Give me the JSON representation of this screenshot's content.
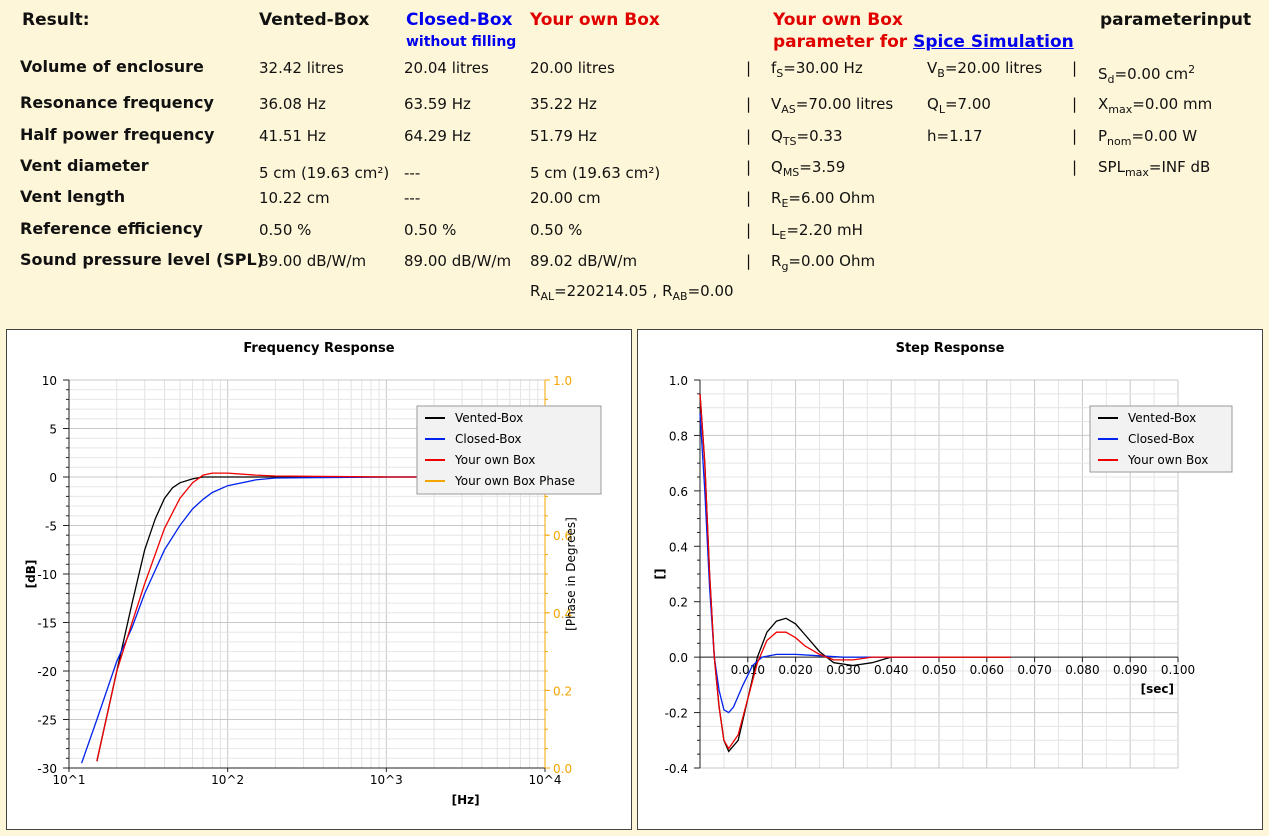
{
  "headers": {
    "result": "Result:",
    "vented": "Vented-Box",
    "closed": "Closed-Box",
    "closed_sub": "without filling",
    "own": "Your own Box",
    "spice_title": "Your own Box",
    "spice_sub_prefix": "parameter for ",
    "spice_link": "Spice Simulation",
    "param_input": "parameterinput"
  },
  "rows": [
    {
      "label": "Volume of enclosure",
      "vented": "32.42 litres",
      "closed": "20.04 litres",
      "own": "20.00 litres"
    },
    {
      "label": "Resonance frequency",
      "vented": "36.08 Hz",
      "closed": "63.59 Hz",
      "own": "35.22 Hz"
    },
    {
      "label": "Half power frequency",
      "vented": "41.51 Hz",
      "closed": "64.29 Hz",
      "own": "51.79 Hz"
    },
    {
      "label": "Vent diameter",
      "vented": "5 cm (19.63 cm²)",
      "closed": "---",
      "own": "5 cm (19.63 cm²)"
    },
    {
      "label": "Vent length",
      "vented": "10.22 cm",
      "closed": "---",
      "own": "20.00 cm"
    },
    {
      "label": "Reference efficiency",
      "vented": "0.50 %",
      "closed": "0.50 %",
      "own": "0.50 %"
    },
    {
      "label": "Sound pressure level (SPL)",
      "vented": "89.00 dB/W/m",
      "closed": "89.00 dB/W/m",
      "own": "89.02 dB/W/m"
    }
  ],
  "ral": {
    "ral_label": "R",
    "ral_sub": "AL",
    "ral_value": "=220214.05 , ",
    "rab_label": "R",
    "rab_sub": "AB",
    "rab_value": "=0.00"
  },
  "spice_params": [
    {
      "label": "f",
      "sub": "S",
      "value": "=30.00 Hz"
    },
    {
      "label": "V",
      "sub": "AS",
      "value": "=70.00 litres"
    },
    {
      "label": "Q",
      "sub": "TS",
      "value": "=0.33"
    },
    {
      "label": "Q",
      "sub": "MS",
      "value": "=3.59"
    },
    {
      "label": "R",
      "sub": "E",
      "value": "=6.00 Ohm"
    },
    {
      "label": "L",
      "sub": "E",
      "value": "=2.20 mH"
    },
    {
      "label": "R",
      "sub": "g",
      "value": "=0.00 Ohm"
    }
  ],
  "spice_params2": [
    {
      "label": "V",
      "sub": "B",
      "value": "=20.00 litres"
    },
    {
      "label": "Q",
      "sub": "L",
      "value": "=7.00"
    },
    {
      "label": "h",
      "sub": "",
      "value": "=1.17"
    }
  ],
  "input_params": [
    {
      "label": "S",
      "sub": "d",
      "value": "=0.00 cm",
      "sup": "2"
    },
    {
      "label": "X",
      "sub": "max",
      "value": "=0.00 mm",
      "sup": ""
    },
    {
      "label": "P",
      "sub": "nom",
      "value": "=0.00 W",
      "sup": ""
    },
    {
      "label": "SPL",
      "sub": "max",
      "value": "=INF dB",
      "sup": ""
    }
  ],
  "separator": "|",
  "colors": {
    "vented": "#000000",
    "closed": "#0022ee",
    "own": "#ee0000",
    "phase": "#f5a500"
  },
  "chart_data": [
    {
      "type": "line",
      "title": "Frequency Response",
      "xlabel": "[Hz]",
      "ylabel": "[dB]",
      "y2label": "[Phase in Degrees]",
      "xscale": "log",
      "xlim": [
        10,
        10000
      ],
      "ylim": [
        -30,
        10
      ],
      "y2lim": [
        0.0,
        1.0
      ],
      "x_ticks": [
        "10^1",
        "10^2",
        "10^3",
        "10^4"
      ],
      "y_ticks": [
        "10",
        "5",
        "0",
        "-5",
        "-10",
        "-15",
        "-20",
        "-25",
        "-30"
      ],
      "y2_ticks": [
        "1.0",
        "0.8",
        "0.6",
        "0.4",
        "0.2",
        "0.0"
      ],
      "legend_position": "top-right",
      "series": [
        {
          "name": "Vented-Box",
          "x": [
            15,
            20,
            25,
            30,
            35,
            40,
            45,
            50,
            60,
            70,
            80,
            100,
            200,
            1000,
            10000
          ],
          "y": [
            -29.3,
            -20,
            -13,
            -7.5,
            -4.3,
            -2.2,
            -1.1,
            -0.6,
            -0.2,
            0,
            0,
            0,
            0,
            0,
            0
          ]
        },
        {
          "name": "Closed-Box",
          "x": [
            12,
            15,
            20,
            25,
            30,
            40,
            50,
            60,
            70,
            80,
            100,
            150,
            200,
            1000,
            10000
          ],
          "y": [
            -29.5,
            -25,
            -19,
            -15.5,
            -12,
            -7.5,
            -5,
            -3.3,
            -2.3,
            -1.6,
            -0.9,
            -0.3,
            -0.1,
            0,
            0
          ]
        },
        {
          "name": "Your own Box",
          "x": [
            15,
            20,
            25,
            30,
            40,
            50,
            60,
            70,
            80,
            100,
            150,
            200,
            1000,
            10000
          ],
          "y": [
            -29.3,
            -20,
            -15,
            -11,
            -5.3,
            -2.2,
            -0.6,
            0.2,
            0.4,
            0.4,
            0.2,
            0.1,
            0,
            0
          ]
        },
        {
          "name": "Your own Box Phase",
          "x": [],
          "y": []
        }
      ]
    },
    {
      "type": "line",
      "title": "Step Response",
      "xlabel": "[sec]",
      "ylabel": "[]",
      "xlim": [
        0,
        0.1
      ],
      "ylim": [
        -0.4,
        1.0
      ],
      "x_ticks": [
        "0.010",
        "0.020",
        "0.030",
        "0.040",
        "0.050",
        "0.060",
        "0.070",
        "0.080",
        "0.090",
        "0.100"
      ],
      "y_ticks": [
        "1.0",
        "0.8",
        "0.6",
        "0.4",
        "0.2",
        "0.0",
        "-0.2",
        "-0.4"
      ],
      "legend_position": "top-right",
      "series": [
        {
          "name": "Vented-Box",
          "x": [
            0,
            0.001,
            0.002,
            0.003,
            0.004,
            0.005,
            0.006,
            0.008,
            0.01,
            0.012,
            0.014,
            0.016,
            0.018,
            0.02,
            0.022,
            0.025,
            0.028,
            0.032,
            0.036,
            0.04,
            0.05,
            0.065
          ],
          "y": [
            0.95,
            0.7,
            0.3,
            0.0,
            -0.18,
            -0.3,
            -0.34,
            -0.3,
            -0.15,
            0.0,
            0.09,
            0.13,
            0.14,
            0.12,
            0.08,
            0.02,
            -0.02,
            -0.03,
            -0.02,
            0,
            0,
            0
          ]
        },
        {
          "name": "Closed-Box",
          "x": [
            0,
            0.001,
            0.002,
            0.003,
            0.004,
            0.005,
            0.006,
            0.007,
            0.009,
            0.011,
            0.013,
            0.016,
            0.02,
            0.025,
            0.03,
            0.04,
            0.05
          ],
          "y": [
            0.88,
            0.6,
            0.25,
            0.0,
            -0.12,
            -0.19,
            -0.2,
            -0.18,
            -0.1,
            -0.03,
            0.0,
            0.01,
            0.01,
            0.005,
            0,
            0,
            0
          ]
        },
        {
          "name": "Your own Box",
          "x": [
            0,
            0.001,
            0.002,
            0.003,
            0.004,
            0.005,
            0.006,
            0.008,
            0.01,
            0.012,
            0.014,
            0.016,
            0.018,
            0.02,
            0.022,
            0.025,
            0.028,
            0.032,
            0.036,
            0.04,
            0.05,
            0.065
          ],
          "y": [
            0.95,
            0.7,
            0.3,
            0.0,
            -0.18,
            -0.3,
            -0.33,
            -0.28,
            -0.15,
            -0.02,
            0.06,
            0.09,
            0.09,
            0.07,
            0.04,
            0.01,
            -0.01,
            -0.01,
            0,
            0,
            0,
            0
          ]
        }
      ]
    }
  ]
}
